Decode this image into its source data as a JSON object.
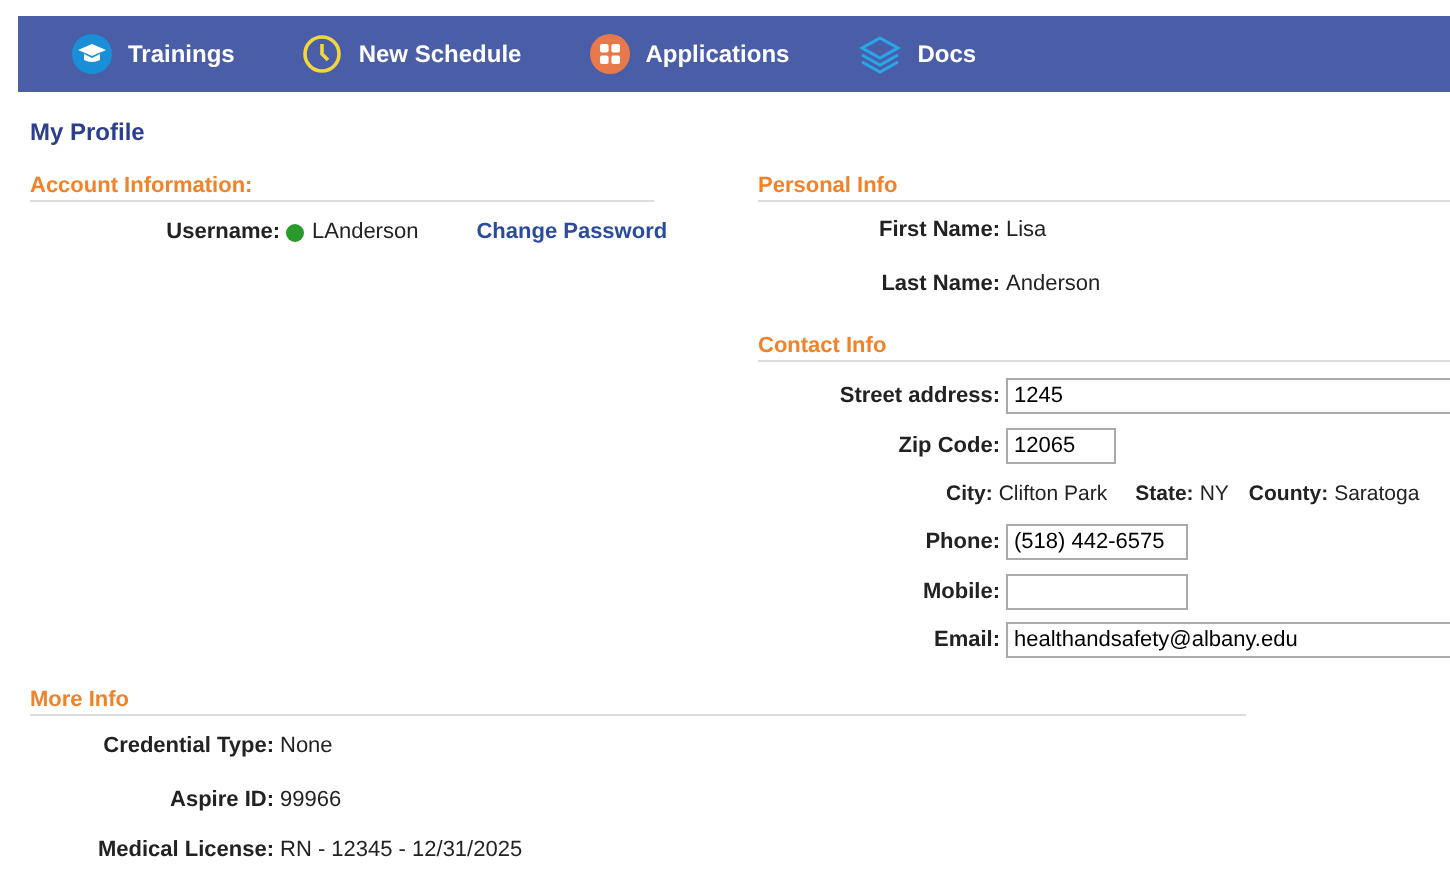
{
  "nav": [
    {
      "label": "Trainings"
    },
    {
      "label": "New Schedule"
    },
    {
      "label": "Applications"
    },
    {
      "label": "Docs"
    }
  ],
  "page_title": "My Profile",
  "account": {
    "title": "Account Information:",
    "username_label": "Username:",
    "username": "LAnderson",
    "change_password": "Change Password"
  },
  "personal": {
    "title": "Personal Info",
    "fields": [
      {
        "label": "First Name:",
        "value": "Lisa"
      },
      {
        "label": "Last Name:",
        "value": "Anderson"
      }
    ]
  },
  "contact": {
    "title": "Contact Info",
    "rows": [
      {
        "kind": "input",
        "label": "Street address:",
        "value": "1245"
      },
      {
        "kind": "input",
        "label": "Zip Code:",
        "value": "12065"
      },
      {
        "kind": "inline",
        "items": [
          {
            "label": "City:",
            "value": "Clifton Park"
          },
          {
            "label": "State:",
            "value": "NY"
          },
          {
            "label": "County:",
            "value": "Saratoga"
          }
        ]
      },
      {
        "kind": "input",
        "label": "Phone:",
        "value": "(518) 442-6575"
      },
      {
        "kind": "input",
        "label": "Mobile:",
        "value": ""
      },
      {
        "kind": "input",
        "label": "Email:",
        "value": "healthandsafety@albany.edu"
      }
    ]
  },
  "more": {
    "title": "More Info",
    "fields": [
      {
        "label": "Credential Type:",
        "value": "None"
      },
      {
        "label": "Aspire ID:",
        "value": "99966"
      },
      {
        "label": "Medical License:",
        "value": "RN - 12345 - 12/31/2025"
      }
    ]
  }
}
